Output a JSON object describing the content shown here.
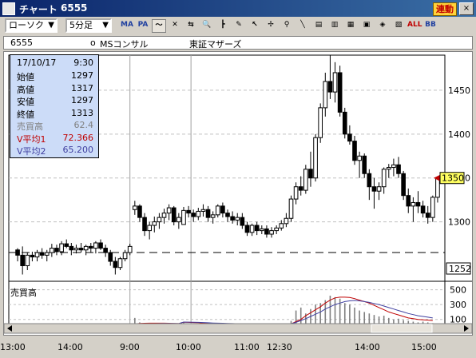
{
  "window": {
    "title": "チャート",
    "code": "6555",
    "linked_button": "連動",
    "close_glyph": "×"
  },
  "toolbar": {
    "chart_type": "ローソク",
    "interval": "5分足",
    "buttons": [
      {
        "name": "ma-button",
        "label": "MA"
      },
      {
        "name": "pa-button",
        "label": "PA"
      },
      {
        "name": "line-wave-button",
        "label": "〜",
        "selected": true
      },
      {
        "name": "tool-button-2",
        "label": "✕"
      },
      {
        "name": "tool-button-3",
        "label": "⇆"
      },
      {
        "name": "zoom-button",
        "label": "🔍"
      },
      {
        "name": "bars-button",
        "label": "┣"
      },
      {
        "name": "pen-button",
        "label": "✎"
      },
      {
        "name": "cursor-button",
        "label": "↖"
      },
      {
        "name": "cross-button",
        "label": "✢"
      },
      {
        "name": "search-button",
        "label": "⚲"
      },
      {
        "name": "trend-button",
        "label": "╲"
      },
      {
        "name": "list-button-1",
        "label": "▤"
      },
      {
        "name": "list-button-2",
        "label": "▥"
      },
      {
        "name": "list-button-3",
        "label": "▦"
      },
      {
        "name": "chart-button-1",
        "label": "▣"
      },
      {
        "name": "chart-button-2",
        "label": "◈"
      },
      {
        "name": "chart-button-3",
        "label": "▧"
      },
      {
        "name": "all-button",
        "label": "ALL"
      },
      {
        "name": "bb-button",
        "label": "BB"
      }
    ]
  },
  "info_bar": {
    "code": "6555",
    "market_mark": "o",
    "company": "MSコンサル",
    "market": "東証マザーズ"
  },
  "info_box": {
    "date": "17/10/17",
    "time": "9:30",
    "rows": [
      {
        "label": "始値",
        "value": "1297",
        "color": "#000000"
      },
      {
        "label": "高値",
        "value": "1317",
        "color": "#000000"
      },
      {
        "label": "安値",
        "value": "1297",
        "color": "#000000"
      },
      {
        "label": "終値",
        "value": "1313",
        "color": "#000000"
      },
      {
        "label": "売買高",
        "value": "62.4",
        "color": "#808080"
      },
      {
        "label": "V平均1",
        "value": "72.366",
        "color": "#c00000"
      },
      {
        "label": "V平均2",
        "value": "65.200",
        "color": "#4040a0"
      }
    ]
  },
  "price_axis": {
    "labels": [
      "1450",
      "1400",
      "1350",
      "1300"
    ],
    "current_price": "1350",
    "dashed_price": "1252"
  },
  "volume_pane": {
    "title": "売買高",
    "labels": [
      "500",
      "300",
      "100"
    ]
  },
  "x_axis": {
    "labels": [
      "13:00",
      "14:00",
      "9:00",
      "10:00",
      "11:00",
      "12:30",
      "14:00",
      "15:00"
    ]
  },
  "chart_data": {
    "type": "candlestick",
    "ylim": [
      1235,
      1490
    ],
    "volume_ylim": [
      0,
      560
    ],
    "candles": [
      [
        1268,
        1270,
        1255,
        1262
      ],
      [
        1262,
        1272,
        1240,
        1250
      ],
      [
        1250,
        1265,
        1245,
        1262
      ],
      [
        1262,
        1266,
        1255,
        1260
      ],
      [
        1260,
        1268,
        1255,
        1265
      ],
      [
        1265,
        1270,
        1258,
        1262
      ],
      [
        1262,
        1268,
        1255,
        1265
      ],
      [
        1265,
        1275,
        1260,
        1270
      ],
      [
        1270,
        1274,
        1262,
        1266
      ],
      [
        1266,
        1278,
        1262,
        1275
      ],
      [
        1275,
        1280,
        1270,
        1272
      ],
      [
        1272,
        1276,
        1262,
        1268
      ],
      [
        1268,
        1274,
        1264,
        1270
      ],
      [
        1270,
        1276,
        1265,
        1268
      ],
      [
        1268,
        1274,
        1262,
        1272
      ],
      [
        1272,
        1276,
        1265,
        1270
      ],
      [
        1270,
        1278,
        1264,
        1276
      ],
      [
        1276,
        1280,
        1268,
        1270
      ],
      [
        1270,
        1274,
        1260,
        1265
      ],
      [
        1265,
        1268,
        1250,
        1255
      ],
      [
        1255,
        1260,
        1240,
        1248
      ],
      [
        1248,
        1260,
        1245,
        1258
      ],
      [
        1258,
        1268,
        1255,
        1265
      ],
      [
        1265,
        1275,
        1262,
        1272
      ],
      [
        1314,
        1324,
        1308,
        1318
      ],
      [
        1318,
        1320,
        1300,
        1305
      ],
      [
        1305,
        1310,
        1284,
        1290
      ],
      [
        1290,
        1300,
        1280,
        1296
      ],
      [
        1296,
        1306,
        1288,
        1300
      ],
      [
        1300,
        1310,
        1292,
        1305
      ],
      [
        1305,
        1315,
        1298,
        1310
      ],
      [
        1310,
        1320,
        1302,
        1316
      ],
      [
        1316,
        1318,
        1296,
        1300
      ],
      [
        1300,
        1310,
        1292,
        1305
      ],
      [
        1297,
        1317,
        1297,
        1313
      ],
      [
        1313,
        1318,
        1305,
        1310
      ],
      [
        1310,
        1314,
        1300,
        1306
      ],
      [
        1306,
        1316,
        1302,
        1312
      ],
      [
        1312,
        1320,
        1306,
        1314
      ],
      [
        1314,
        1318,
        1300,
        1305
      ],
      [
        1305,
        1312,
        1298,
        1308
      ],
      [
        1308,
        1320,
        1305,
        1318
      ],
      [
        1318,
        1322,
        1305,
        1310
      ],
      [
        1310,
        1314,
        1300,
        1306
      ],
      [
        1306,
        1312,
        1298,
        1302
      ],
      [
        1302,
        1310,
        1296,
        1305
      ],
      [
        1305,
        1310,
        1292,
        1296
      ],
      [
        1296,
        1300,
        1284,
        1288
      ],
      [
        1288,
        1298,
        1284,
        1296
      ],
      [
        1296,
        1300,
        1285,
        1290
      ],
      [
        1290,
        1296,
        1286,
        1292
      ],
      [
        1292,
        1296,
        1282,
        1286
      ],
      [
        1286,
        1294,
        1282,
        1290
      ],
      [
        1290,
        1296,
        1286,
        1293
      ],
      [
        1293,
        1302,
        1290,
        1298
      ],
      [
        1298,
        1310,
        1294,
        1304
      ],
      [
        1304,
        1330,
        1300,
        1326
      ],
      [
        1326,
        1345,
        1320,
        1340
      ],
      [
        1340,
        1352,
        1330,
        1336
      ],
      [
        1336,
        1365,
        1332,
        1360
      ],
      [
        1360,
        1380,
        1340,
        1350
      ],
      [
        1350,
        1400,
        1346,
        1396
      ],
      [
        1396,
        1435,
        1390,
        1430
      ],
      [
        1430,
        1470,
        1420,
        1460
      ],
      [
        1460,
        1490,
        1440,
        1448
      ],
      [
        1448,
        1482,
        1436,
        1470
      ],
      [
        1470,
        1478,
        1420,
        1425
      ],
      [
        1425,
        1430,
        1395,
        1400
      ],
      [
        1400,
        1410,
        1388,
        1392
      ],
      [
        1392,
        1398,
        1365,
        1370
      ],
      [
        1370,
        1380,
        1350,
        1375
      ],
      [
        1375,
        1378,
        1350,
        1355
      ],
      [
        1355,
        1360,
        1325,
        1340
      ],
      [
        1340,
        1350,
        1315,
        1335
      ],
      [
        1335,
        1345,
        1325,
        1340
      ],
      [
        1340,
        1362,
        1332,
        1360
      ],
      [
        1360,
        1366,
        1350,
        1362
      ],
      [
        1362,
        1372,
        1352,
        1365
      ],
      [
        1365,
        1374,
        1350,
        1355
      ],
      [
        1355,
        1358,
        1325,
        1330
      ],
      [
        1330,
        1338,
        1310,
        1318
      ],
      [
        1318,
        1328,
        1300,
        1322
      ],
      [
        1322,
        1335,
        1310,
        1318
      ],
      [
        1318,
        1324,
        1305,
        1310
      ],
      [
        1310,
        1318,
        1298,
        1305
      ],
      [
        1305,
        1330,
        1300,
        1328
      ],
      [
        1328,
        1352,
        1322,
        1350
      ]
    ],
    "volume": [
      30,
      25,
      20,
      22,
      28,
      20,
      18,
      24,
      22,
      20,
      26,
      24,
      20,
      18,
      22,
      24,
      20,
      26,
      30,
      28,
      32,
      26,
      22,
      24,
      120,
      60,
      40,
      36,
      32,
      30,
      28,
      34,
      36,
      30,
      62,
      32,
      28,
      26,
      30,
      34,
      30,
      28,
      26,
      24,
      30,
      28,
      32,
      34,
      30,
      28,
      26,
      24,
      28,
      30,
      36,
      40,
      80,
      220,
      260,
      180,
      240,
      300,
      320,
      360,
      420,
      400,
      380,
      320,
      300,
      260,
      220,
      200,
      180,
      160,
      140,
      150,
      120,
      100,
      110,
      90,
      80,
      70,
      60,
      70,
      60,
      50
    ],
    "vol_avg1": [
      30,
      30,
      28,
      26,
      26,
      25,
      24,
      24,
      23,
      23,
      23,
      22,
      22,
      21,
      21,
      22,
      22,
      22,
      22,
      22,
      24,
      25,
      26,
      27,
      40,
      45,
      48,
      50,
      50,
      50,
      49,
      48,
      46,
      44,
      62,
      60,
      58,
      56,
      52,
      48,
      44,
      40,
      38,
      36,
      34,
      33,
      32,
      32,
      31,
      30,
      30,
      29,
      29,
      29,
      30,
      32,
      40,
      70,
      100,
      150,
      190,
      230,
      270,
      320,
      360,
      390,
      400,
      400,
      395,
      380,
      360,
      340,
      320,
      290,
      260,
      230,
      200,
      180,
      160,
      140,
      120,
      110,
      100,
      95,
      90,
      85
    ],
    "vol_avg2": [
      40,
      38,
      36,
      34,
      32,
      30,
      29,
      28,
      27,
      26,
      26,
      25,
      25,
      24,
      24,
      24,
      24,
      24,
      24,
      24,
      25,
      26,
      26,
      27,
      35,
      38,
      40,
      42,
      43,
      44,
      45,
      45,
      45,
      44,
      65,
      64,
      62,
      60,
      58,
      55,
      52,
      50,
      48,
      46,
      44,
      42,
      41,
      40,
      39,
      38,
      37,
      36,
      35,
      35,
      36,
      37,
      42,
      60,
      85,
      110,
      140,
      170,
      200,
      240,
      270,
      300,
      320,
      340,
      350,
      355,
      350,
      340,
      330,
      315,
      300,
      280,
      260,
      240,
      220,
      200,
      180,
      165,
      150,
      140,
      130,
      120
    ]
  }
}
